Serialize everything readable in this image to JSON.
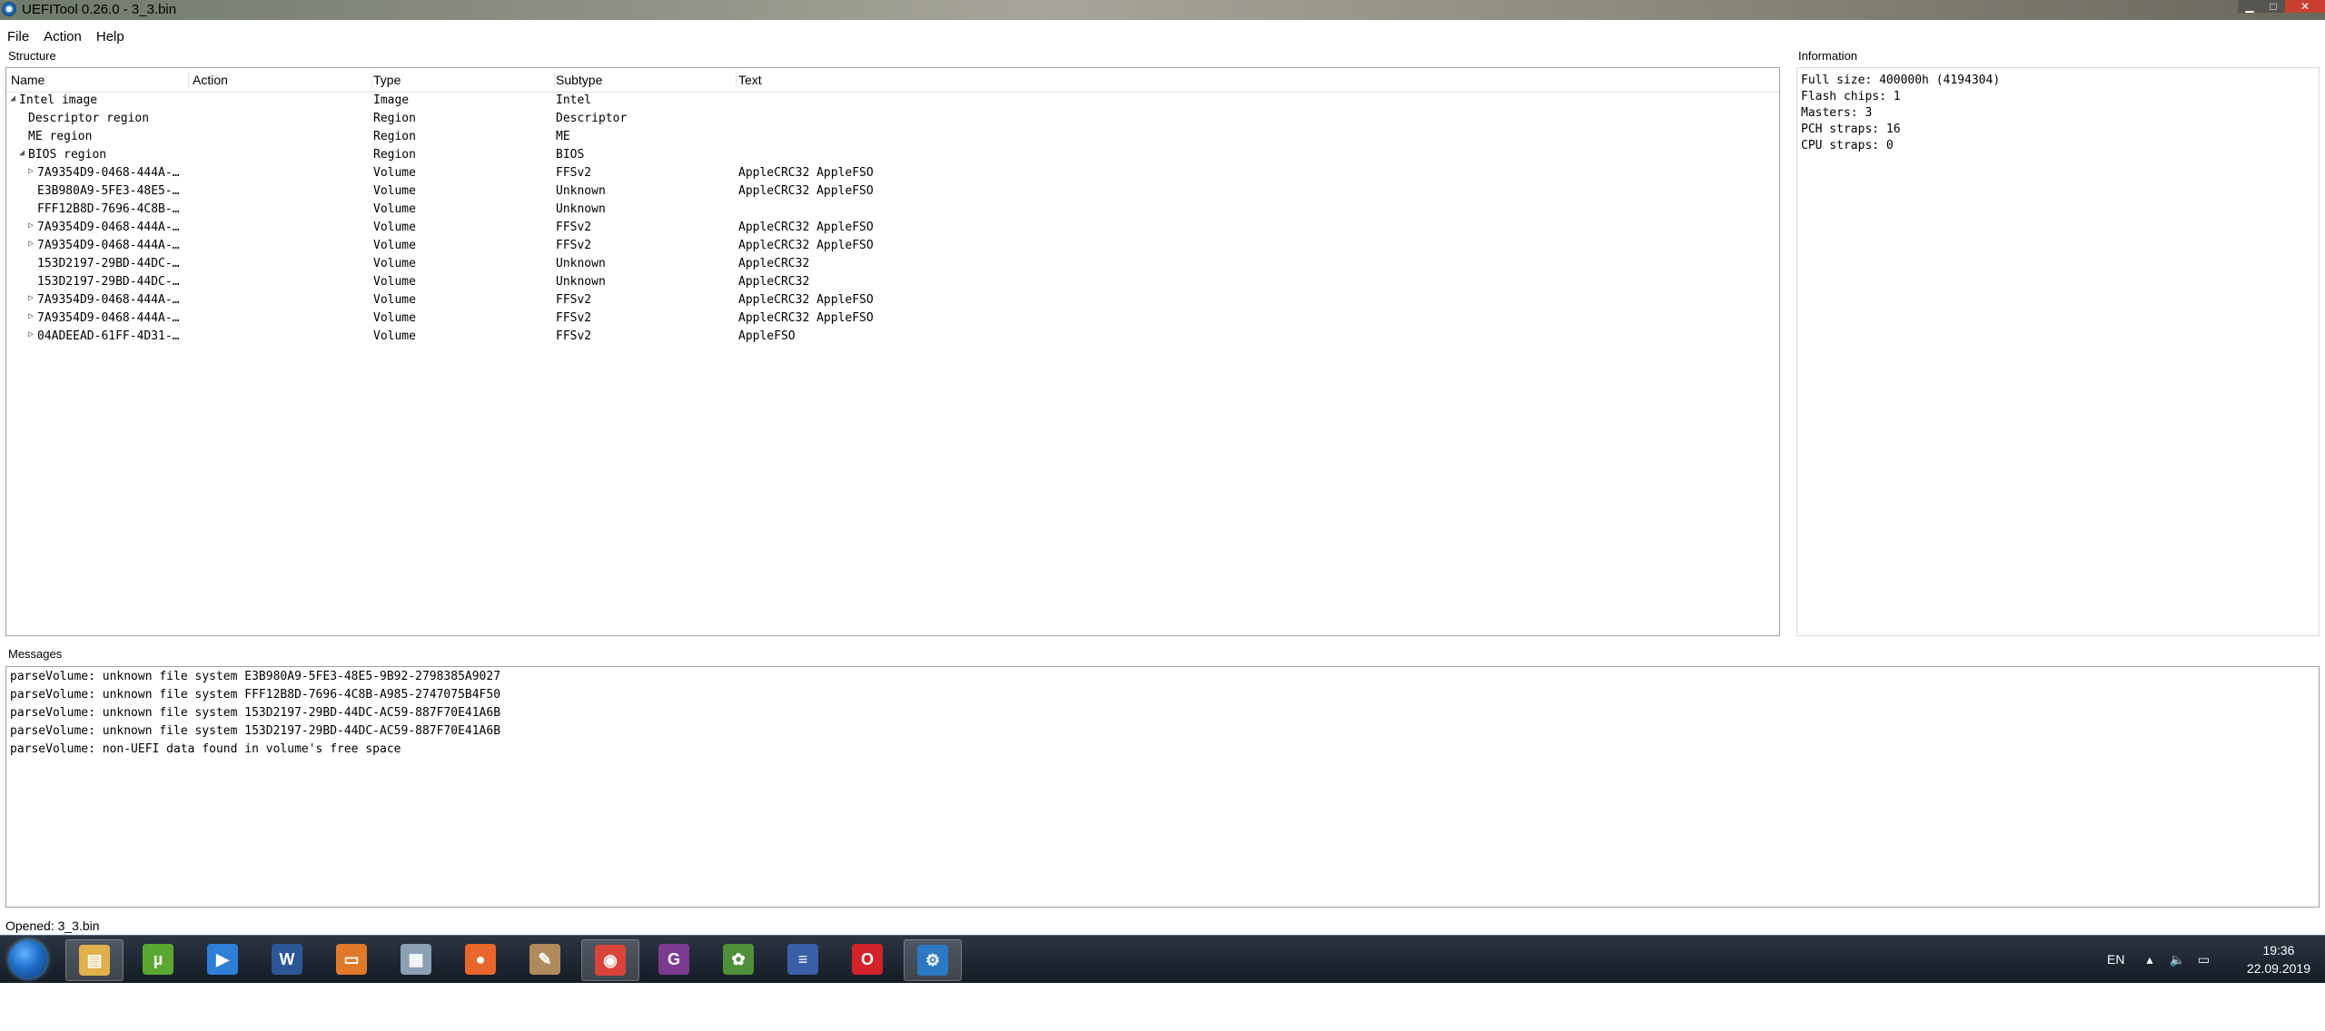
{
  "window": {
    "title": "UEFITool 0.26.0 - 3_3.bin"
  },
  "menu": [
    "File",
    "Action",
    "Help"
  ],
  "structure": {
    "label": "Structure",
    "columns": [
      "Name",
      "Action",
      "Type",
      "Subtype",
      "Text"
    ],
    "rows": [
      {
        "indent": 0,
        "arrow": "◢",
        "name": "Intel image",
        "action": "",
        "type": "Image",
        "subtype": "Intel",
        "text": ""
      },
      {
        "indent": 1,
        "arrow": "",
        "name": "Descriptor region",
        "action": "",
        "type": "Region",
        "subtype": "Descriptor",
        "text": ""
      },
      {
        "indent": 1,
        "arrow": "",
        "name": "ME region",
        "action": "",
        "type": "Region",
        "subtype": "ME",
        "text": ""
      },
      {
        "indent": 1,
        "arrow": "◢",
        "name": "BIOS region",
        "action": "",
        "type": "Region",
        "subtype": "BIOS",
        "text": ""
      },
      {
        "indent": 2,
        "arrow": "▷",
        "name": "7A9354D9-0468-444A-…",
        "action": "",
        "type": "Volume",
        "subtype": "FFSv2",
        "text": "AppleCRC32 AppleFSO"
      },
      {
        "indent": 2,
        "arrow": "",
        "name": "E3B980A9-5FE3-48E5-…",
        "action": "",
        "type": "Volume",
        "subtype": "Unknown",
        "text": "AppleCRC32 AppleFSO"
      },
      {
        "indent": 2,
        "arrow": "",
        "name": "FFF12B8D-7696-4C8B-…",
        "action": "",
        "type": "Volume",
        "subtype": "Unknown",
        "text": ""
      },
      {
        "indent": 2,
        "arrow": "▷",
        "name": "7A9354D9-0468-444A-…",
        "action": "",
        "type": "Volume",
        "subtype": "FFSv2",
        "text": "AppleCRC32 AppleFSO"
      },
      {
        "indent": 2,
        "arrow": "▷",
        "name": "7A9354D9-0468-444A-…",
        "action": "",
        "type": "Volume",
        "subtype": "FFSv2",
        "text": "AppleCRC32 AppleFSO"
      },
      {
        "indent": 2,
        "arrow": "",
        "name": "153D2197-29BD-44DC-…",
        "action": "",
        "type": "Volume",
        "subtype": "Unknown",
        "text": "AppleCRC32"
      },
      {
        "indent": 2,
        "arrow": "",
        "name": "153D2197-29BD-44DC-…",
        "action": "",
        "type": "Volume",
        "subtype": "Unknown",
        "text": "AppleCRC32"
      },
      {
        "indent": 2,
        "arrow": "▷",
        "name": "7A9354D9-0468-444A-…",
        "action": "",
        "type": "Volume",
        "subtype": "FFSv2",
        "text": "AppleCRC32 AppleFSO"
      },
      {
        "indent": 2,
        "arrow": "▷",
        "name": "7A9354D9-0468-444A-…",
        "action": "",
        "type": "Volume",
        "subtype": "FFSv2",
        "text": "AppleCRC32 AppleFSO"
      },
      {
        "indent": 2,
        "arrow": "▷",
        "name": "04ADEEAD-61FF-4D31-…",
        "action": "",
        "type": "Volume",
        "subtype": "FFSv2",
        "text": "AppleFSO"
      }
    ]
  },
  "information": {
    "label": "Information",
    "lines": [
      "Full size: 400000h (4194304)",
      "Flash chips: 1",
      "Masters: 3",
      "PCH straps: 16",
      "CPU straps: 0"
    ]
  },
  "messages": {
    "label": "Messages",
    "lines": [
      "parseVolume: unknown file system E3B980A9-5FE3-48E5-9B92-2798385A9027",
      "parseVolume: unknown file system FFF12B8D-7696-4C8B-A985-2747075B4F50",
      "parseVolume: unknown file system 153D2197-29BD-44DC-AC59-887F70E41A6B",
      "parseVolume: unknown file system 153D2197-29BD-44DC-AC59-887F70E41A6B",
      "parseVolume: non-UEFI data found in volume's free space"
    ]
  },
  "statusbar": {
    "text": "Opened: 3_3.bin"
  },
  "taskbar": {
    "apps": [
      {
        "name": "explorer-icon",
        "glyph": "▤",
        "color": "#e0b04a",
        "active": true
      },
      {
        "name": "utorrent-icon",
        "glyph": "µ",
        "color": "#5aa832",
        "active": false
      },
      {
        "name": "media-player-icon",
        "glyph": "▶",
        "color": "#2f7fd8",
        "active": false
      },
      {
        "name": "word-icon",
        "glyph": "W",
        "color": "#2b5797",
        "active": false
      },
      {
        "name": "slides-icon",
        "glyph": "▭",
        "color": "#e07a2a",
        "active": false
      },
      {
        "name": "calculator-icon",
        "glyph": "▦",
        "color": "#8aa0b4",
        "active": false
      },
      {
        "name": "firefox-icon",
        "glyph": "●",
        "color": "#e8662a",
        "active": false
      },
      {
        "name": "image-viewer-icon",
        "glyph": "✎",
        "color": "#b08a5c",
        "active": false
      },
      {
        "name": "chrome-icon",
        "glyph": "◉",
        "color": "#d9433a",
        "active": true
      },
      {
        "name": "pdf-icon",
        "glyph": "G",
        "color": "#7b3a8f",
        "active": false
      },
      {
        "name": "image-editor-icon",
        "glyph": "✿",
        "color": "#4f8f3a",
        "active": false
      },
      {
        "name": "document-icon",
        "glyph": "≡",
        "color": "#3a5fa8",
        "active": false
      },
      {
        "name": "opera-icon",
        "glyph": "O",
        "color": "#d3222a",
        "active": false
      },
      {
        "name": "uefitool-icon",
        "glyph": "⚙",
        "color": "#2b79c2",
        "active": true
      }
    ],
    "tray": {
      "language": "EN"
    },
    "clock": {
      "time": "19:36",
      "date": "22.09.2019"
    }
  }
}
